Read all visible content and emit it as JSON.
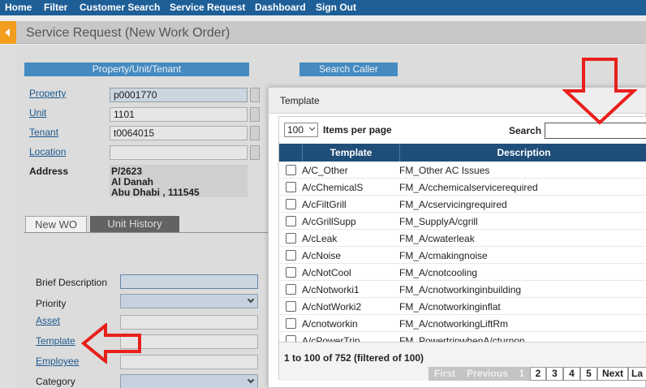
{
  "nav": {
    "items": [
      "Home",
      "Filter",
      "Customer Search",
      "Service Request",
      "Dashboard",
      "Sign Out"
    ]
  },
  "page": {
    "title": "Service Request (New Work Order)"
  },
  "sections": {
    "property": "Property/Unit/Tenant",
    "caller": "Search Caller"
  },
  "fields": {
    "property_label": "Property",
    "property_value": "p0001770",
    "unit_label": "Unit",
    "unit_value": "1101",
    "tenant_label": "Tenant",
    "tenant_value": "t0064015",
    "location_label": "Location",
    "location_value": "",
    "address_label": "Address",
    "address_lines": [
      "P/2623",
      "Al Danah",
      "Abu Dhabi , 111545"
    ]
  },
  "tabs": {
    "new_wo": "New WO",
    "unit_history": "Unit History"
  },
  "wo_form": {
    "brief_description": "Brief Description",
    "priority": "Priority",
    "asset": "Asset",
    "template": "Template",
    "employee": "Employee",
    "category": "Category"
  },
  "modal": {
    "title": "Template",
    "per_page_value": "100",
    "per_page_label": "Items per page",
    "search_label": "Search",
    "search_value": "",
    "columns": [
      "Template",
      "Description"
    ],
    "rows": [
      {
        "template": "A/C_Other",
        "description": "FM_Other AC Issues"
      },
      {
        "template": "A/cChemicalS",
        "description": "FM_A/cchemicalservicerequired"
      },
      {
        "template": "A/cFiltGrill",
        "description": "FM_A/cservicingrequired"
      },
      {
        "template": "A/cGrillSupp",
        "description": "FM_SupplyA/cgrill"
      },
      {
        "template": "A/cLeak",
        "description": "FM_A/cwaterleak"
      },
      {
        "template": "A/cNoise",
        "description": "FM_A/cmakingnoise"
      },
      {
        "template": "A/cNotCool",
        "description": "FM_A/cnotcooling"
      },
      {
        "template": "A/cNotworki1",
        "description": "FM_A/cnotworkinginbuilding"
      },
      {
        "template": "A/cNotWorki2",
        "description": "FM_A/cnotworkinginflat"
      },
      {
        "template": "A/cnotworkin",
        "description": "FM_A/cnotworkingLiftRm"
      },
      {
        "template": "A/cPowerTrip",
        "description": "FM_PowertripwhenA/cturnon"
      }
    ],
    "info": "1 to 100 of 752 (filtered of 100)",
    "pager": {
      "first": "First",
      "previous": "Previous",
      "pages": [
        "1",
        "2",
        "3",
        "4",
        "5"
      ],
      "next": "Next",
      "last": "La"
    }
  },
  "colors": {
    "nav_bg": "#1f5f98",
    "section_bar": "#4a94cf",
    "grid_header": "#1f4e79",
    "annotation_red": "#e8201c"
  },
  "icons": {
    "collapse": "triangle-left-icon",
    "annotation_down": "red-arrow-down-icon",
    "annotation_left": "red-arrow-left-icon"
  }
}
